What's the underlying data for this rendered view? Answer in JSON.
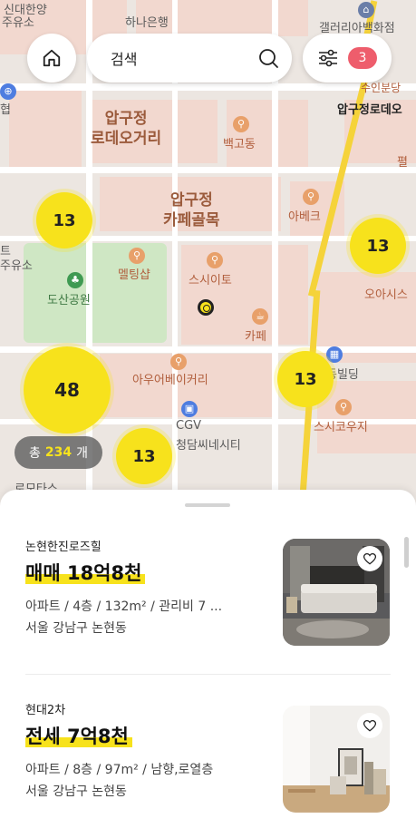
{
  "map": {
    "labels": {
      "hana_bank": "하나은행",
      "galleria": "갤러리아백화점",
      "sinsa_top": "신대한양",
      "gas_station_top": "주유소",
      "apgujeong_rodeo_street": "압구정\n로데오거리",
      "baekgodong": "백고동",
      "apgujeong_rodeo_station": "압구정로데오",
      "sinbundang": "수인분당",
      "apgujeong_cafe": "압구정\n카페골목",
      "abeke": "아베크",
      "meltingshop": "멜팅샵",
      "sushi_ito": "스시이토",
      "dosan_park": "도산공원",
      "cafe": "카페",
      "oasis": "오아시스",
      "auer_bakery": "아우어베이커리",
      "building": "동빌딩",
      "sushi_kouji": "스시코우지",
      "cgv": "CGV",
      "cgv_cheongdam": "청담씨네시티",
      "gas_station_left": "주유소",
      "store_left": "트",
      "hyeop": "협",
      "pyeol": "펼",
      "bottom_left": "로모타스"
    },
    "clusters": [
      {
        "id": "cluster-1",
        "count": "13"
      },
      {
        "id": "cluster-2",
        "count": "13"
      },
      {
        "id": "cluster-3",
        "count": "48"
      },
      {
        "id": "cluster-4",
        "count": "13"
      },
      {
        "id": "cluster-5",
        "count": "13"
      }
    ]
  },
  "topbar": {
    "search_placeholder": "검색",
    "filter_count": "3"
  },
  "total": {
    "prefix": "총",
    "count": "234",
    "suffix": "개"
  },
  "listings": [
    {
      "name": "논현한진로즈힐",
      "price": "매매 18억8천",
      "desc": "아파트 / 4층 / 132m² / 관리비 7 ...",
      "address": "서울 강남구 논현동"
    },
    {
      "name": "현대2차",
      "price": "전세 7억8천",
      "desc": "아파트 / 8층 / 97m² / 남향,로열층",
      "address": "서울 강남구 논현동"
    }
  ],
  "colors": {
    "accent_yellow": "#f7e21c",
    "badge_red": "#ee5d6c",
    "route_yellow": "#f5d33a"
  }
}
